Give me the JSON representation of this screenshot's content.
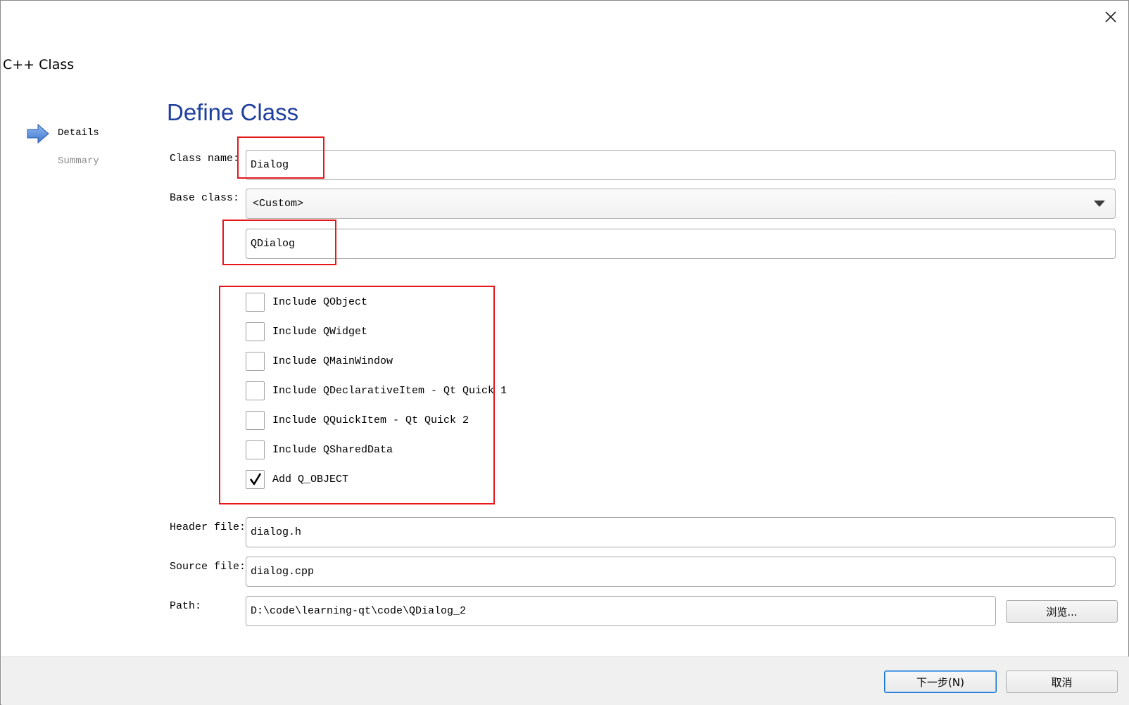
{
  "window": {
    "title": "C++ Class",
    "close_icon": "close-icon"
  },
  "side_nav": {
    "items": [
      {
        "label": "Details",
        "state": "active",
        "icon": "arrow-right-icon"
      },
      {
        "label": "Summary",
        "state": "inactive"
      }
    ]
  },
  "page": {
    "title": "Define Class"
  },
  "form": {
    "class_name_label": "Class name:",
    "class_name_value": "Dialog",
    "base_class_label": "Base class:",
    "base_class_selected": "<Custom>",
    "custom_base_value": "QDialog",
    "checkboxes": [
      {
        "label": "Include QObject",
        "checked": false
      },
      {
        "label": "Include QWidget",
        "checked": false
      },
      {
        "label": "Include QMainWindow",
        "checked": false
      },
      {
        "label": "Include QDeclarativeItem - Qt Quick 1",
        "checked": false
      },
      {
        "label": "Include QQuickItem - Qt Quick 2",
        "checked": false
      },
      {
        "label": "Include QSharedData",
        "checked": false
      },
      {
        "label": "Add Q_OBJECT",
        "checked": true
      }
    ],
    "header_file_label": "Header file:",
    "header_file_value": "dialog.h",
    "source_file_label": "Source file:",
    "source_file_value": "dialog.cpp",
    "path_label": "Path:",
    "path_value": "D:\\code\\learning-qt\\code\\QDialog_2",
    "browse_label": "浏览..."
  },
  "footer": {
    "next_label": "下一步(N)",
    "cancel_label": "取消"
  },
  "colors": {
    "title_blue": "#1f3f9e",
    "highlight_red": "#e5171b",
    "arrow_blue": "#4a86dc"
  }
}
